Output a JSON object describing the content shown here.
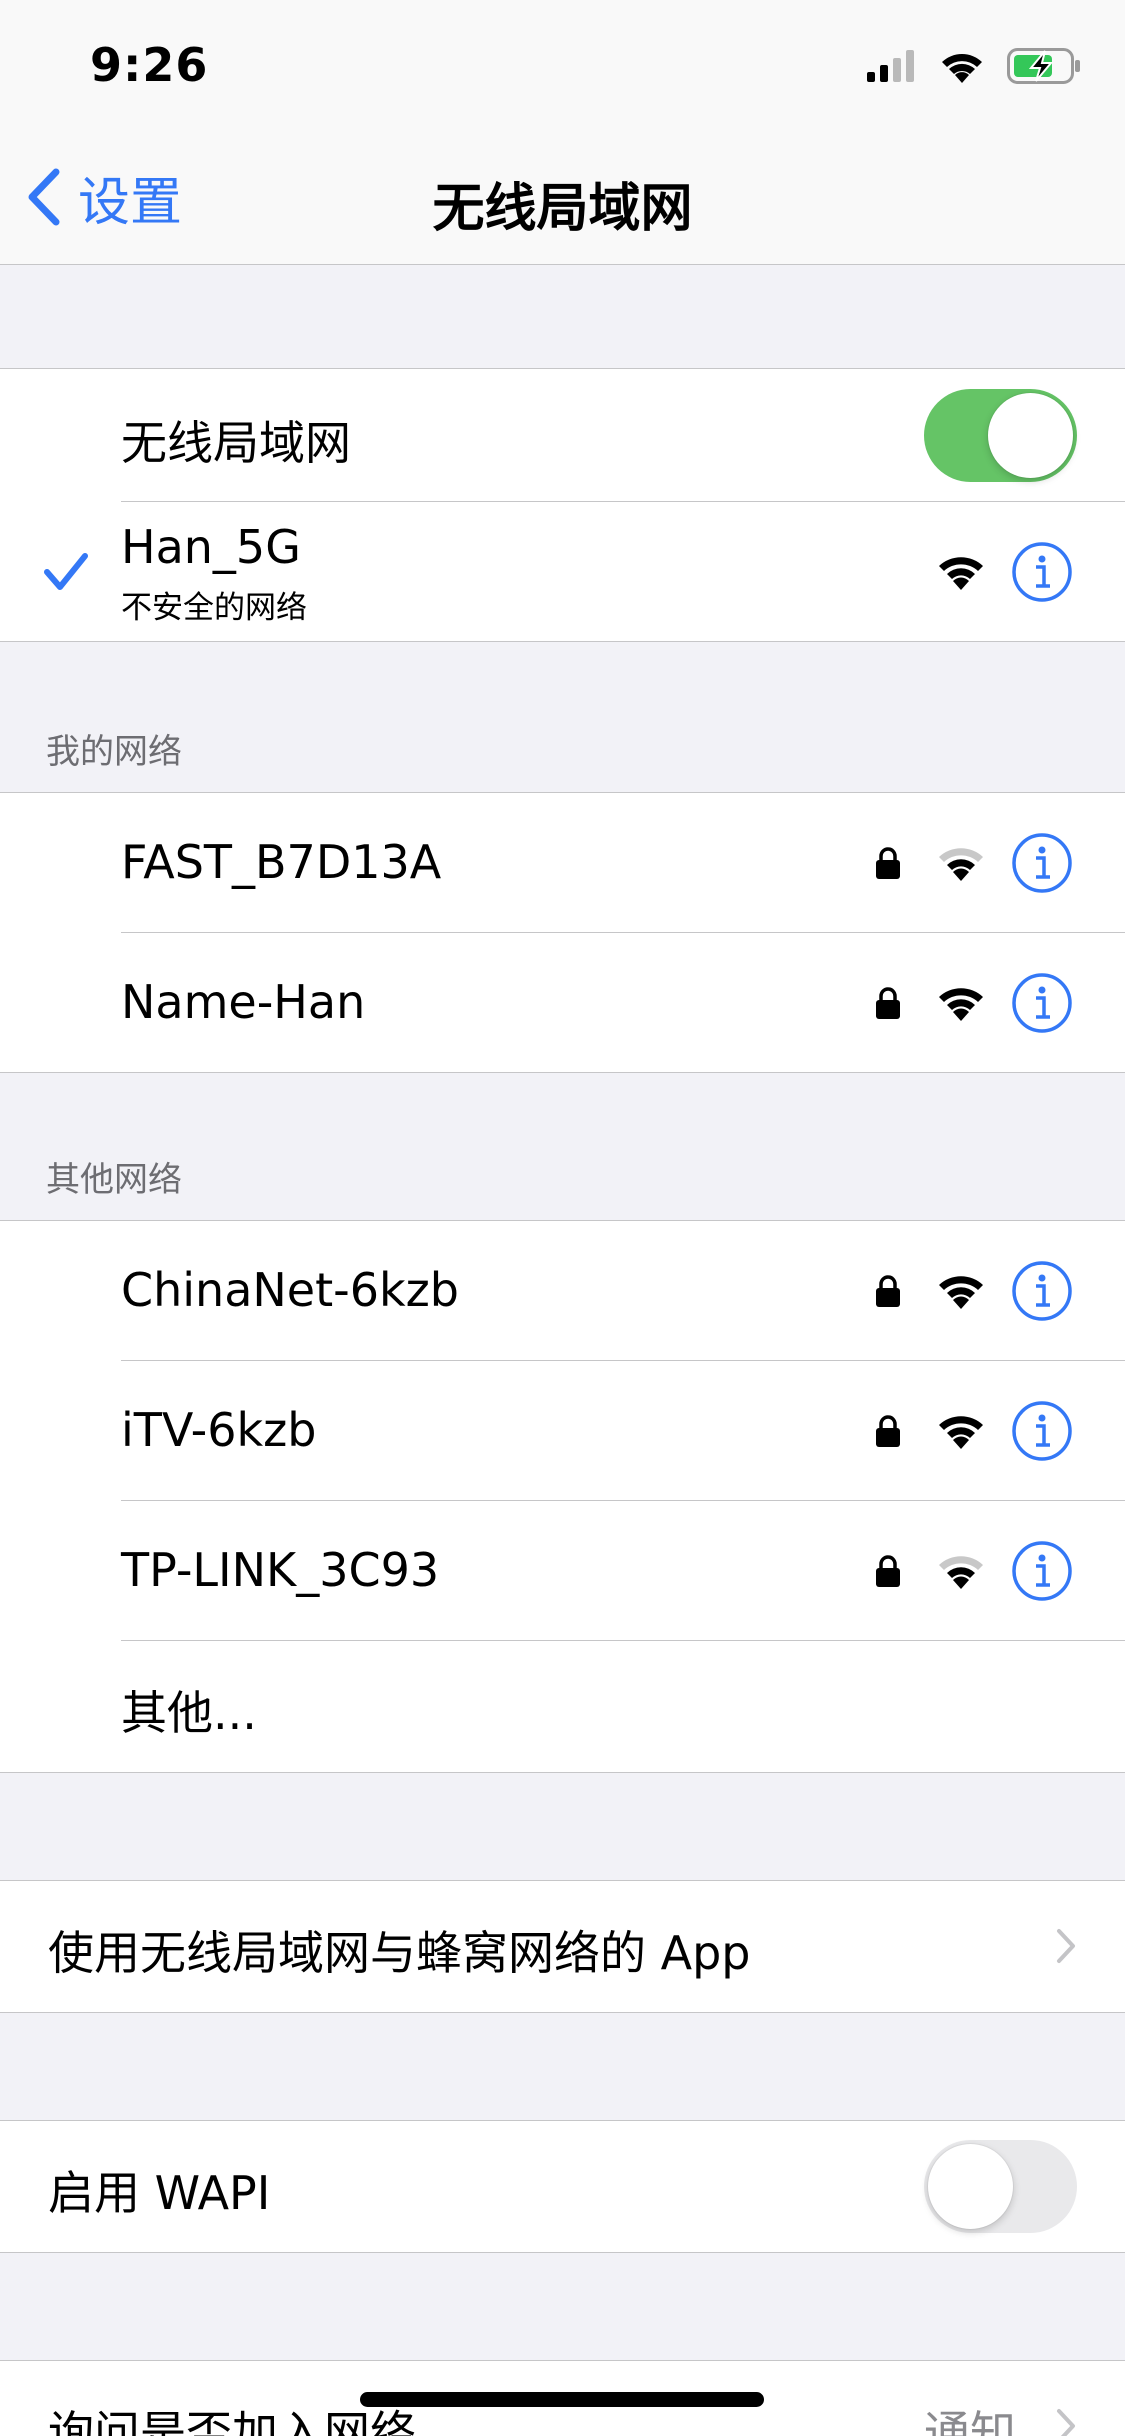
{
  "status_bar": {
    "time": "9:26"
  },
  "nav": {
    "back_label": "设置",
    "title": "无线局域网"
  },
  "wifi_group": {
    "toggle_label": "无线局域网",
    "toggle_on": true,
    "connected": {
      "name": "Han_5G",
      "subtitle": "不安全的网络"
    }
  },
  "my_networks": {
    "header": "我的网络",
    "items": [
      {
        "name": "FAST_B7D13A",
        "secured": true,
        "signal": 2
      },
      {
        "name": "Name-Han",
        "secured": true,
        "signal": 3
      }
    ]
  },
  "other_networks": {
    "header": "其他网络",
    "items": [
      {
        "name": "ChinaNet-6kzb",
        "secured": true,
        "signal": 3
      },
      {
        "name": "iTV-6kzb",
        "secured": true,
        "signal": 3
      },
      {
        "name": "TP-LINK_3C93",
        "secured": true,
        "signal": 2
      }
    ],
    "other_label": "其他..."
  },
  "apps_row": {
    "label": "使用无线局域网与蜂窝网络的 App"
  },
  "wapi_row": {
    "label": "启用 WAPI",
    "toggle_on": false
  },
  "ask_join_row": {
    "label": "询问是否加入网络",
    "value": "通知"
  },
  "colors": {
    "accent": "#3478f6",
    "toggle_on": "#65c466",
    "background": "#f2f2f7"
  }
}
